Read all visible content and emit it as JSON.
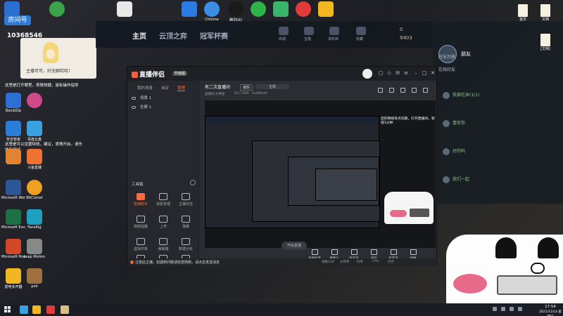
{
  "desktop": {
    "top_icons": [
      {
        "label": "",
        "color": "#2a6fd0"
      },
      {
        "label": "",
        "color": "#3aa34a"
      },
      {
        "label": "",
        "color": "#e0e0e0"
      },
      {
        "label": "",
        "color": "#2c7be5"
      },
      {
        "label": "Chrome",
        "color": "#3a8ee6"
      },
      {
        "label": "腾讯QQ",
        "color": "#1a1a1a"
      },
      {
        "label": "",
        "color": "#2fb24c"
      },
      {
        "label": "",
        "color": "#3ab46a"
      },
      {
        "label": "",
        "color": "#e23b3b"
      },
      {
        "label": "",
        "color": "#f2b620"
      }
    ],
    "left_icons": [
      {
        "label": "BandiZip",
        "color": "#2d6fd4"
      },
      {
        "label": "安全管家",
        "color": "#2a7ed8"
      },
      {
        "label": "",
        "color": "#e08430"
      },
      {
        "label": "Microsoft Word 2010",
        "color": "#2b5797"
      },
      {
        "label": "Microsoft Excel 2010",
        "color": "#1e7145"
      },
      {
        "label": "Microsoft PowerPoint",
        "color": "#d24726"
      },
      {
        "label": "雷电多开器",
        "color": "#f2b620"
      }
    ],
    "left_icons_col2": [
      {
        "label": "",
        "color": "#d04a8a"
      },
      {
        "label": "百度云盘",
        "color": "#3aa0e0"
      },
      {
        "label": "斗鱼直播",
        "color": "#f07030"
      },
      {
        "label": "BitComet",
        "color": "#f0a020"
      },
      {
        "label": "FaceRig",
        "color": "#20a0c0"
      },
      {
        "label": "Leap Motion",
        "color": "#888888"
      },
      {
        "label": "pxb",
        "color": "#a07040"
      }
    ],
    "tips": [
      "这里是打开哪里，表情快捷，鼠标操作指导",
      "这里是可以设置特效，建议，表情开启，请先体验测试"
    ],
    "right_icons": [
      {
        "label": "首页"
      },
      {
        "label": "文档"
      },
      {
        "label": "[文档]"
      }
    ]
  },
  "room_card": {
    "badge": "房间号",
    "number": "10368546"
  },
  "anchor_popup": {
    "message": "主播可可，好无聊哈哈！"
  },
  "game": {
    "tabs": [
      "主页",
      "云顶之弈",
      "冠军杯赛"
    ],
    "icons": [
      "商城",
      "宝箱",
      "资料库",
      "收藏"
    ],
    "gold_value": "0",
    "gold_value2": "9403",
    "username": "朋友",
    "panel_title": "好友列表",
    "online_label": "在线好友",
    "friends": [
      "我爱吃米(1/1)",
      "喜欢你",
      "好的吗",
      "我们一起"
    ]
  },
  "app": {
    "title": "直播伴侣",
    "version": "升级版",
    "sidebar_tabs": [
      "我的场景",
      "自定",
      "管理"
    ],
    "scenes": [
      "场景 1",
      "全屏 1"
    ],
    "tools_label": "工具箱",
    "tools": [
      "直播助手",
      "观看管理",
      "主播日志",
      "视频提醒",
      "上传",
      "弹幕",
      "虚拟形象",
      "弹幕箱",
      "数据分析",
      "",
      "",
      ""
    ],
    "room_title": "有二次直播间",
    "edit_btn": "编辑",
    "category": "主机",
    "meta_left": "直播间:天秤座",
    "meta_mid": "ID:77899",
    "meta_right": "10368546",
    "float_text": "您的网络有点问题，打开直播间，获得1分钟",
    "bottom_tools": [
      "直播背景",
      "摄像头",
      "麦克风",
      "录屏",
      "麦克风",
      "弹幕"
    ],
    "golive": "开始直播",
    "footer_notice": "注意此主播，如遇到问题请检查网络，请点击发送消息",
    "footer_stats": [
      "帧数100",
      "分辨率",
      "码率",
      "CPU",
      "内存"
    ]
  },
  "taskbar": {
    "apps": [
      {
        "color": "#3aa0e0"
      },
      {
        "color": "#f2b620"
      },
      {
        "color": "#e23b3b"
      },
      {
        "color": "#d8c080"
      }
    ],
    "time": "17:54",
    "date": "2021/11/14 星期日"
  }
}
